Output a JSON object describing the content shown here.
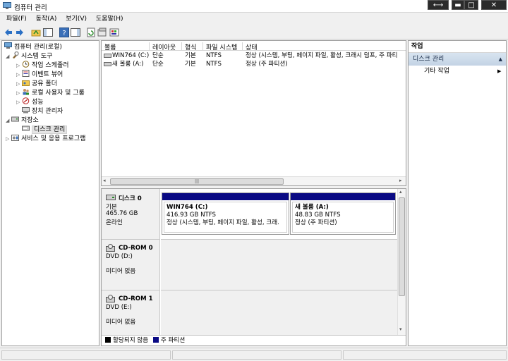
{
  "window": {
    "title": "컴퓨터 관리"
  },
  "window_controls": {
    "restore": "⟷",
    "minimize": "▬",
    "maximize": "□",
    "close": "✕"
  },
  "menu": [
    "파일(F)",
    "동작(A)",
    "보기(V)",
    "도움말(H)"
  ],
  "tree": {
    "root": "컴퓨터 관리(로컬)",
    "system_tools": "시스템 도구",
    "task_scheduler": "작업 스케줄러",
    "event_viewer": "이벤트 뷰어",
    "shared_folders": "공유 폴더",
    "local_users": "로컬 사용자 및 그룹",
    "performance": "성능",
    "device_manager": "장치 관리자",
    "storage": "저장소",
    "disk_management": "디스크 관리",
    "services": "서비스 및 응용 프로그램"
  },
  "volume_list": {
    "headers": [
      "볼륨",
      "레이아웃",
      "형식",
      "파일 시스템",
      "상태"
    ],
    "rows": [
      {
        "volume": "WIN764 (C:)",
        "layout": "단순",
        "type": "기본",
        "fs": "NTFS",
        "status": "정상 (시스템, 부팅, 페이지 파일, 활성, 크래시 덤프, 주 파티"
      },
      {
        "volume": "새 볼륨 (A:)",
        "layout": "단순",
        "type": "기본",
        "fs": "NTFS",
        "status": "정상 (주 파티션)"
      }
    ],
    "scroll_grip": "|||"
  },
  "disks": [
    {
      "name": "디스크 0",
      "type": "기본",
      "size": "465.76 GB",
      "state": "온라인"
    },
    {
      "name": "CD-ROM 0",
      "type": "DVD (D:)",
      "state": "미디어 없음"
    },
    {
      "name": "CD-ROM 1",
      "type": "DVD (E:)",
      "state": "미디어 없음"
    }
  ],
  "partitions": [
    {
      "name": "WIN764  (C:)",
      "size": "416.93 GB NTFS",
      "status": "정상 (시스템, 부팅, 페이지 파일, 활성, 크래."
    },
    {
      "name": "새 볼륨  (A:)",
      "size": "48.83 GB NTFS",
      "status": "정상 (주 파티션)"
    }
  ],
  "legend": {
    "unallocated": "할당되지 않음",
    "primary": "주 파티션"
  },
  "colors": {
    "primary_partition": "#0a0a84",
    "unallocated": "#000000"
  },
  "actions": {
    "header": "작업",
    "section": "디스크 관리",
    "more": "기타 작업"
  }
}
